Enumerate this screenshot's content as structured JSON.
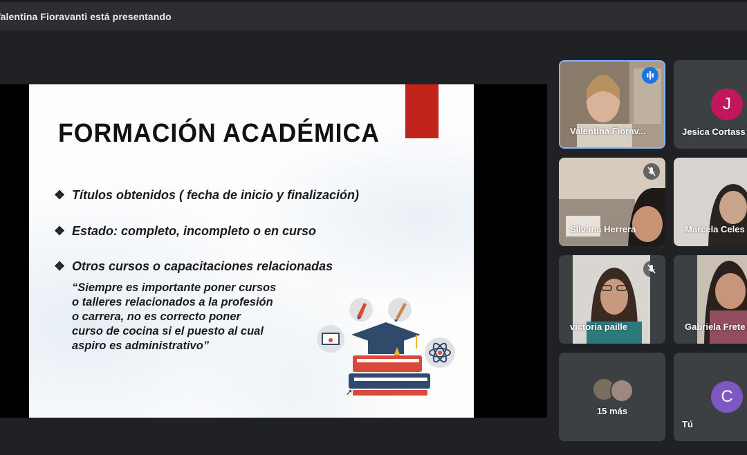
{
  "banner": {
    "text": "Valentina Fioravanti está presentando"
  },
  "slide": {
    "title": "FORMACIÓN ACADÉMICA",
    "bullets": [
      "Títulos obtenidos ( fecha de inicio y finalización)",
      "Estado: completo, incompleto o en curso",
      "Otros cursos o capacitaciones relacionadas"
    ],
    "bullet_mark": "❖",
    "quote_lines": [
      "“Siempre es importante poner cursos",
      "o talleres relacionados a la profesión",
      "o carrera, no es correcto poner",
      "curso de cocina si el puesto al cual",
      "aspiro es administrativo”"
    ]
  },
  "participants": [
    {
      "name": "Valentina Fiorav...",
      "state": "speaking"
    },
    {
      "name": "Jesica Cortass",
      "initial": "J",
      "color": "#c2185b"
    },
    {
      "name": "Silvana Herrera",
      "state": "muted"
    },
    {
      "name": "Marcela Celes"
    },
    {
      "name": "victoria paille",
      "state": "muted"
    },
    {
      "name": "Gabriela Frete"
    },
    {
      "name": "15 más"
    },
    {
      "name": "Tú",
      "initial": "C",
      "color": "#7e57c2"
    }
  ],
  "colors": {
    "accent": "#8ab4f8",
    "slide_red": "#c0241a",
    "tile": "#3c4043",
    "background": "#202124"
  }
}
